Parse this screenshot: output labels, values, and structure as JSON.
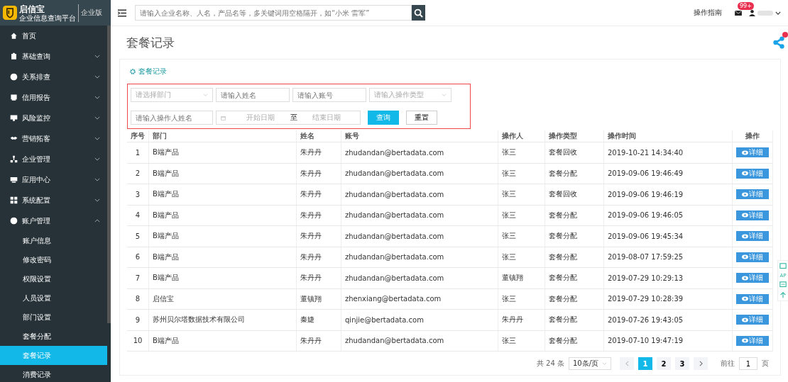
{
  "brand": {
    "name": "启信宝",
    "tagline": "企业信息查询平台",
    "edition": "企业版"
  },
  "search": {
    "placeholder": "请输入企业名称、人名，产品名等，多关键词用空格隔开，如“小米 雷军”"
  },
  "header": {
    "guide": "操作指南",
    "mail_badge": "99+"
  },
  "sidebar": {
    "items": [
      {
        "label": "首页",
        "kind": "link"
      },
      {
        "label": "基础查询",
        "kind": "group",
        "expanded": false
      },
      {
        "label": "关系排查",
        "kind": "group",
        "expanded": false
      },
      {
        "label": "信用报告",
        "kind": "group",
        "expanded": false
      },
      {
        "label": "风险监控",
        "kind": "group",
        "expanded": false
      },
      {
        "label": "营销拓客",
        "kind": "group",
        "expanded": false
      },
      {
        "label": "企业管理",
        "kind": "group",
        "expanded": false
      },
      {
        "label": "应用中心",
        "kind": "group",
        "expanded": false
      },
      {
        "label": "系统配置",
        "kind": "group",
        "expanded": false
      },
      {
        "label": "账户管理",
        "kind": "group",
        "expanded": true,
        "children": [
          {
            "label": "账户信息",
            "selected": false
          },
          {
            "label": "修改密码",
            "selected": false
          },
          {
            "label": "权限设置",
            "selected": false
          },
          {
            "label": "人员设置",
            "selected": false
          },
          {
            "label": "部门设置",
            "selected": false
          },
          {
            "label": "套餐分配",
            "selected": false
          },
          {
            "label": "套餐记录",
            "selected": true
          },
          {
            "label": "消费记录",
            "selected": false
          }
        ]
      }
    ]
  },
  "page_title": "套餐记录",
  "card_title": "套餐记录",
  "filters": [
    {
      "kind": "select",
      "placeholder": "请选择部门"
    },
    {
      "kind": "text",
      "placeholder": "请输入姓名"
    },
    {
      "kind": "text",
      "placeholder": "请输入账号"
    },
    {
      "kind": "select",
      "placeholder": "请输入操作类型"
    },
    {
      "kind": "text",
      "placeholder": "请输入操作人姓名"
    },
    {
      "kind": "daterange",
      "start_placeholder": "开始日期",
      "separator": "至",
      "end_placeholder": "结束日期"
    }
  ],
  "buttons": [
    {
      "label": "查询",
      "kind": "primary"
    },
    {
      "label": "重置",
      "kind": "default"
    }
  ],
  "table": {
    "columns": [
      "序号",
      "部门",
      "姓名",
      "账号",
      "操作人",
      "操作类型",
      "操作时间",
      "操作"
    ],
    "rows": [
      {
        "cells": [
          "1",
          "B端产品",
          "朱丹丹",
          "zhudandan@bertadata.com",
          "张三",
          "套餐回收",
          "2019-10-21 14:34:40"
        ],
        "action": "详细"
      },
      {
        "cells": [
          "2",
          "B端产品",
          "朱丹丹",
          "zhudandan@bertadata.com",
          "张三",
          "套餐分配",
          "2019-09-06 19:46:49"
        ],
        "action": "详细"
      },
      {
        "cells": [
          "3",
          "B端产品",
          "朱丹丹",
          "zhudandan@bertadata.com",
          "张三",
          "套餐回收",
          "2019-09-06 19:46:19"
        ],
        "action": "详细"
      },
      {
        "cells": [
          "4",
          "B端产品",
          "朱丹丹",
          "zhudandan@bertadata.com",
          "张三",
          "套餐分配",
          "2019-09-06 19:46:05"
        ],
        "action": "详细"
      },
      {
        "cells": [
          "5",
          "B端产品",
          "朱丹丹",
          "zhudandan@bertadata.com",
          "张三",
          "套餐分配",
          "2019-09-06 19:45:34"
        ],
        "action": "详细"
      },
      {
        "cells": [
          "6",
          "B端产品",
          "朱丹丹",
          "zhudandan@bertadata.com",
          "张三",
          "套餐分配",
          "2019-08-07 17:59:25"
        ],
        "action": "详细"
      },
      {
        "cells": [
          "7",
          "B端产品",
          "朱丹丹",
          "zhudandan@bertadata.com",
          "董镇翔",
          "套餐分配",
          "2019-07-29 10:29:13"
        ],
        "action": "详细"
      },
      {
        "cells": [
          "8",
          "启信宝",
          "董镇翔",
          "zhenxiang@bertadata.com",
          "张三",
          "套餐分配",
          "2019-07-29 10:28:39"
        ],
        "action": "详细"
      },
      {
        "cells": [
          "9",
          "苏州贝尔塔数据技术有限公司",
          "秦婕",
          "qinjie@bertadata.com",
          "朱丹丹",
          "套餐分配",
          "2019-07-26 19:43:05"
        ],
        "action": "详细"
      },
      {
        "cells": [
          "10",
          "B端产品",
          "朱丹丹",
          "zhudandan@bertadata.com",
          "张三",
          "套餐分配",
          "2019-07-10 19:47:19"
        ],
        "action": "详细"
      }
    ]
  },
  "pagination": {
    "total": "共 24 条",
    "page_size": "10条/页",
    "pages": [
      {
        "label": "1",
        "selected": true
      },
      {
        "label": "2",
        "selected": false
      },
      {
        "label": "3",
        "selected": false
      }
    ],
    "goto_label": "前往",
    "goto_value": "1",
    "goto_suffix": "页"
  },
  "side_tools": {
    "label": "AP"
  }
}
